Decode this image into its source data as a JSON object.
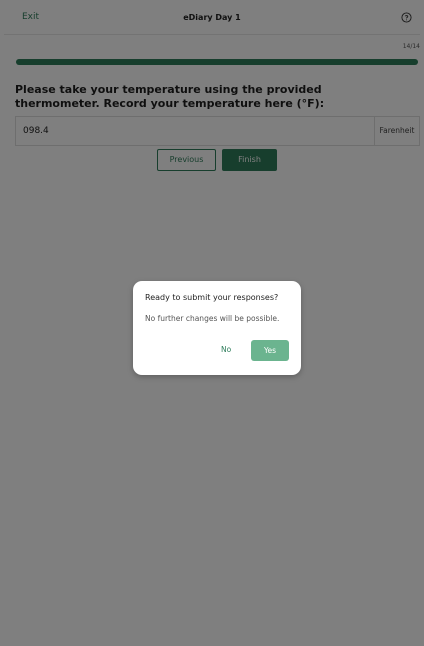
{
  "header": {
    "exit_label": "Exit",
    "title": "eDiary Day 1",
    "help_icon": "question-circle-icon"
  },
  "progress": {
    "label": "14/14",
    "fraction": 1.0
  },
  "question": {
    "text": "Please take your temperature using the provided thermometer. Record your temperature here (°F):",
    "answer_value": "098.4",
    "unit": "Farenheit"
  },
  "navigation": {
    "previous_label": "Previous",
    "finish_label": "Finish"
  },
  "dialog": {
    "title": "Ready to submit your responses?",
    "message": "No further changes will be possible.",
    "no_label": "No",
    "yes_label": "Yes"
  },
  "colors": {
    "accent": "#2e7d5b",
    "accent_light": "#6bb48f",
    "overlay": "rgba(0,0,0,0.5)"
  }
}
